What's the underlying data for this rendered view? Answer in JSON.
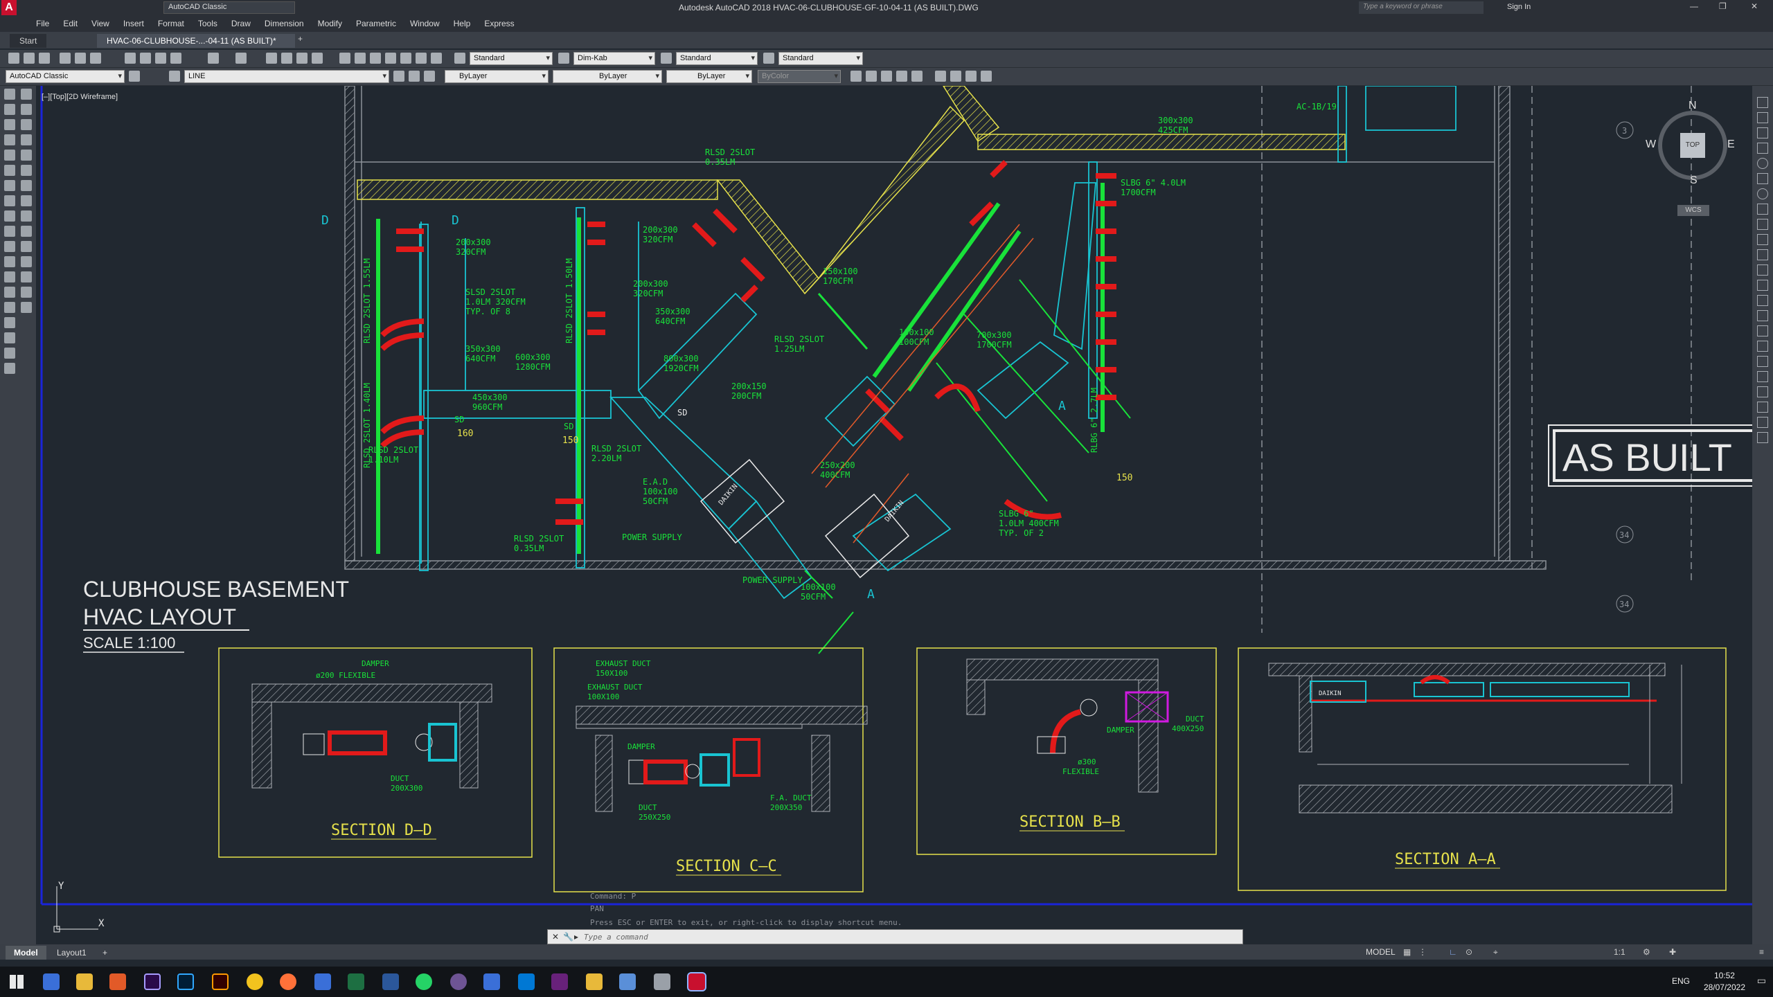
{
  "titlebar": {
    "workspace": "AutoCAD Classic",
    "title": "Autodesk AutoCAD 2018   HVAC-06-CLUBHOUSE-GF-10-04-11 (AS BUILT).DWG",
    "search_placeholder": "Type a keyword or phrase",
    "sign_in": "Sign In"
  },
  "menu": [
    "File",
    "Edit",
    "View",
    "Insert",
    "Format",
    "Tools",
    "Draw",
    "Dimension",
    "Modify",
    "Parametric",
    "Window",
    "Help",
    "Express"
  ],
  "doctabs": {
    "start": "Start",
    "active": "HVAC-06-CLUBHOUSE-...-04-11 (AS BUILT)*"
  },
  "styles_toolbar": {
    "text_style": "Standard",
    "dim_style": "Dim-Kab",
    "table_style": "Standard",
    "multileader_style": "Standard"
  },
  "layers_toolbar": {
    "workspace": "AutoCAD Classic",
    "layer": "LINE",
    "color": "ByLayer",
    "linetype": "ByLayer",
    "lineweight": "ByLayer",
    "plotstyle": "ByColor"
  },
  "viewport_label": "[–][Top][2D Wireframe]",
  "drawing": {
    "title_line1": "CLUBHOUSE BASEMENT",
    "title_line2": "HVAC LAYOUT",
    "scale": "SCALE 1:100",
    "stamp": "AS BUILT",
    "sections": [
      "SECTION D–D",
      "SECTION C–C",
      "SECTION B–B",
      "SECTION A–A"
    ],
    "labels": {
      "rlsd1": "RLSD 2SLOT",
      "rlsd1b": "0.35LM",
      "s200_300": "200x300",
      "cfm320": "320CFM",
      "s350_300": "350x300",
      "cfm640": "640CFM",
      "s600_300": "600x300",
      "cfm1280": "1280CFM",
      "s450_300": "450x300",
      "cfm960": "960CFM",
      "s800_300": "800x300",
      "cfm1920": "1920CFM",
      "slsd": "SLSD 2SLOT",
      "slsd_b": "1.0LM 320CFM",
      "slsd_c": "TYP. OF 8",
      "s150_100": "150x100",
      "cfm170": "170CFM",
      "s100_100": "100x100",
      "cfm100": "100CFM",
      "s700_300": "700x300",
      "cfm1700": "1700CFM",
      "s300_300": "300x300",
      "cfm425": "425CFM",
      "slbg": "SLBG 6\" 4.0LM",
      "cfm1700b": "1700CFM",
      "rlsd_155": "RLSD 2SLOT 1.55LM",
      "rlsd_140": "RLSD 2SLOT 1.40LM",
      "rlsd_150": "RLSD 2SLOT 1.50LM",
      "rlbg_27": "RLBG 6\" 2.7LM",
      "rlsd_110": "RLSD 2SLOT",
      "rlsd_110b": "1.10LM",
      "rlsd_035": "RLSD 2SLOT",
      "rlsd_035b": "0.35LM",
      "rlsd_220": "RLSD 2SLOT",
      "rlsd_220b": "2.20LM",
      "rlsd_125": "RLSD 2SLOT",
      "rlsd_125b": "1.25LM",
      "ead": "E.A.D",
      "ead_s": "100x100",
      "ead_c": "50CFM",
      "power": "POWER SUPPLY",
      "power2": "POWER SUPPLY",
      "s100b": "100x100",
      "cfm50b": "50CFM",
      "s200_150": "200x150",
      "cfm200": "200CFM",
      "s250_200": "250x200",
      "cfm400": "400CFM",
      "slbg6": "SLBG 6\"",
      "slbg6b": "1.0LM 400CFM",
      "slbg6c": "TYP. OF 2",
      "ac1b19": "AC-1B/19",
      "sd": "SD",
      "sd160": "160",
      "sd150": "150",
      "d": "D",
      "a": "A",
      "daikin": "DAIKIN",
      "damper": "DAMPER",
      "flex200": "ø200 FLEXIBLE",
      "duct": "DUCT",
      "duct_s": "200X300",
      "exhaust1": "EXHAUST DUCT",
      "exhaust1b": "150X100",
      "exhaust2": "EXHAUST DUCT",
      "exhaust2b": "100X100",
      "duct250": "DUCT",
      "duct250b": "250X250",
      "fa": "F.A. DUCT",
      "fab": "200X350",
      "ductbb": "DUCT",
      "ductbbb": "400X250",
      "damperbb": "DAMPER",
      "flexbb": "ø300",
      "flexbbb": "FLEXIBLE",
      "n34a": "34",
      "n34b": "34",
      "n3": "3"
    }
  },
  "viewcube": {
    "n": "N",
    "s": "S",
    "e": "E",
    "w": "W",
    "top": "TOP",
    "wcs": "WCS"
  },
  "command": {
    "hist1": "Command: P",
    "hist2": "PAN",
    "hist3": "Press ESC or ENTER to exit, or right-click to display shortcut menu.",
    "placeholder": "Type a command"
  },
  "layouts": [
    "Model",
    "Layout1"
  ],
  "status": {
    "space": "MODEL",
    "scale": "1:1"
  },
  "taskbar": {
    "lang": "ENG",
    "time": "10:52",
    "date": "28/07/2022"
  },
  "colors": {
    "duct_cyan": "#19c4d2",
    "yellow": "#e6e14b",
    "green": "#19e23a",
    "red": "#e21a1a",
    "white": "#e8e8e8",
    "gray": "#8c9198",
    "blue": "#1a24d9"
  }
}
